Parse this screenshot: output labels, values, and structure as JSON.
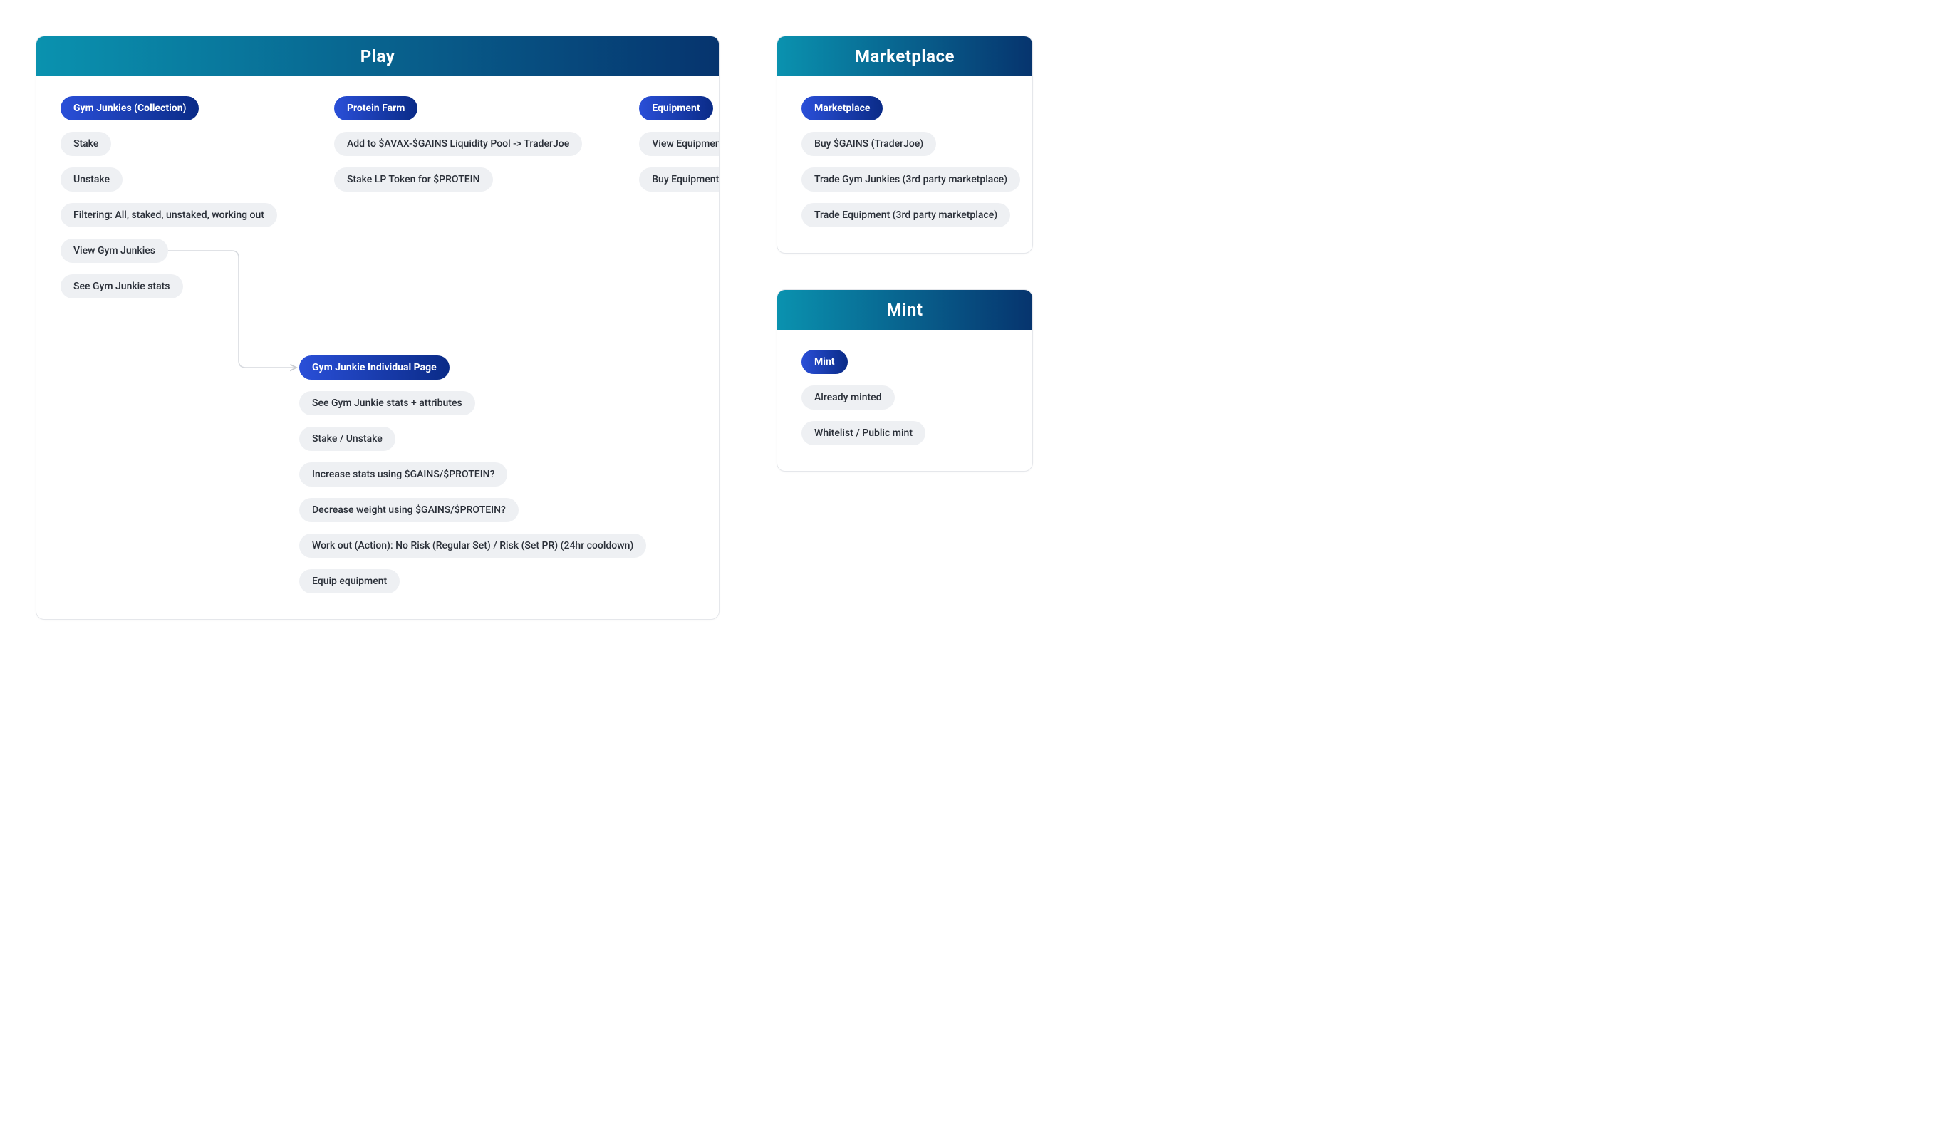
{
  "play": {
    "title": "Play",
    "gym_junkies": {
      "header": "Gym Junkies (Collection)",
      "items": [
        "Stake",
        "Unstake",
        "Filtering: All, staked, unstaked, working out",
        "View Gym Junkies",
        "See Gym Junkie stats"
      ]
    },
    "protein_farm": {
      "header": "Protein Farm",
      "items": [
        "Add to $AVAX-$GAINS Liquidity Pool -> TraderJoe",
        "Stake LP Token for $PROTEIN"
      ]
    },
    "equipment": {
      "header": "Equipment",
      "items": [
        "View Equipment",
        "Buy Equipment - using $PROTEIN"
      ]
    },
    "individual": {
      "header": "Gym Junkie Individual Page",
      "items": [
        "See Gym Junkie stats + attributes",
        "Stake / Unstake",
        "Increase stats using $GAINS/$PROTEIN?",
        "Decrease weight using $GAINS/$PROTEIN?",
        "Work out (Action): No Risk (Regular Set) / Risk (Set PR) (24hr cooldown)",
        "Equip equipment"
      ]
    }
  },
  "marketplace": {
    "title": "Marketplace",
    "header": "Marketplace",
    "items": [
      "Buy $GAINS (TraderJoe)",
      "Trade Gym Junkies (3rd party marketplace)",
      "Trade Equipment (3rd party marketplace)"
    ]
  },
  "mint": {
    "title": "Mint",
    "header": "Mint",
    "items": [
      "Already minted",
      "Whitelist / Public mint"
    ]
  }
}
